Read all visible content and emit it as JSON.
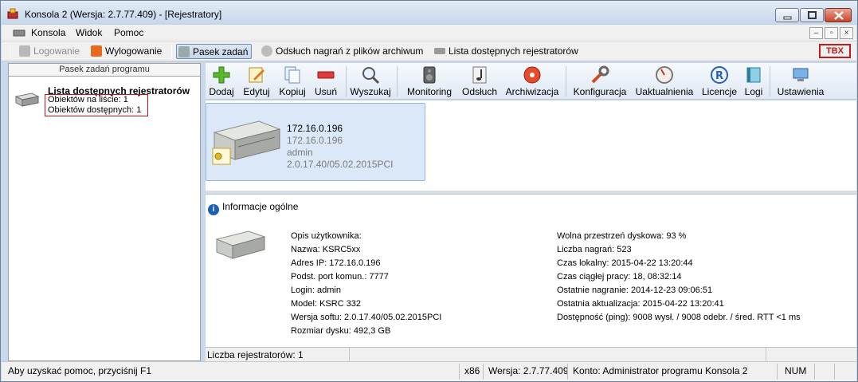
{
  "window": {
    "title": "Konsola 2 (Wersja: 2.7.77.409) - [Rejestratory]"
  },
  "menu": {
    "items": [
      "Konsola",
      "Widok",
      "Pomoc"
    ]
  },
  "taskbar": {
    "login": "Logowanie",
    "logout": "Wylogowanie",
    "tasks": "Pasek zadań",
    "playback": "Odsłuch nagrań z plików archiwum",
    "recorders": "Lista dostępnych rejestratorów",
    "logo": "TBX"
  },
  "left_panel": {
    "header": "Pasek zadań programu",
    "title": "Lista dostępnych rejestratorów",
    "on_list": "Obiektów na liście: 1",
    "available": "Obiektów dostępnych: 1"
  },
  "toolbar": {
    "buttons": [
      "Dodaj",
      "Edytuj",
      "Kopiuj",
      "Usuń",
      "Wyszukaj",
      "Monitoring",
      "Odsłuch",
      "Archiwizacja",
      "Konfiguracja",
      "Uaktualnienia",
      "Licencje",
      "Logi",
      "Ustawienia"
    ]
  },
  "device": {
    "ip": "172.16.0.196",
    "ip2": "172.16.0.196",
    "user": "admin",
    "version": "2.0.17.40/05.02.2015PCI"
  },
  "info": {
    "header": "Informacje ogólne",
    "left": [
      "Opis użytkownika:",
      "Nazwa: KSRC5xx",
      "Adres IP: 172.16.0.196",
      "Podst. port komun.: 7777",
      "Login: admin",
      "Model: KSRC 332",
      "Wersja softu: 2.0.17.40/05.02.2015PCI",
      "Rozmiar dysku: 492,3 GB"
    ],
    "right": [
      "Wolna przestrzeń dyskowa: 93 %",
      "Liczba nagrań: 523",
      "Czas lokalny: 2015-04-22 13:20:44",
      "Czas ciągłej pracy: 18, 08:32:14",
      "Ostatnie nagranie: 2014-12-23 09:06:51",
      "Ostatnia aktualizacja: 2015-04-22 13:20:41",
      "Dostępność (ping): 9008 wysł. / 9008 odebr. / śred. RTT <1 ms"
    ]
  },
  "count": "Liczba rejestratorów: 1",
  "status": {
    "help": "Aby uzyskać pomoc, przyciśnij F1",
    "arch": "x86",
    "version": "Wersja: 2.7.77.409",
    "account": "Konto: Administrator programu Konsola 2",
    "num": "NUM"
  },
  "colors": {
    "titlebar": "#c6d6ea",
    "selection": "#dbe8f7",
    "highlight_box": "#d01010",
    "brand": "#c21c1c"
  }
}
